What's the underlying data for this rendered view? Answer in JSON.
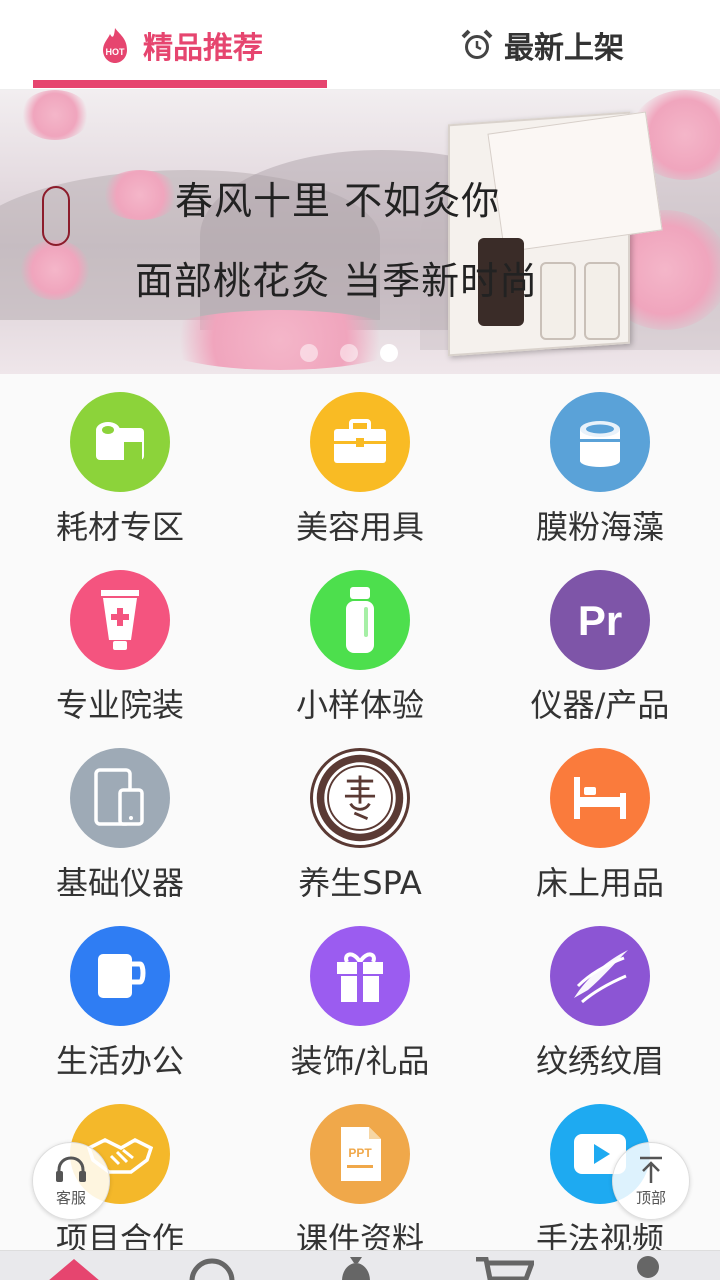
{
  "tabs": {
    "hot": {
      "badge": "HOT",
      "label": "精品推荐"
    },
    "new": {
      "label": "最新上架"
    }
  },
  "banner": {
    "line1": "春风十里 不如灸你",
    "line2": "面部桃花灸 当季新时尚",
    "slides_total": 3,
    "active_slide": 3
  },
  "categories": [
    {
      "label": "耗材专区",
      "icon": "tape-roll-icon",
      "color": "#8cd33a"
    },
    {
      "label": "美容用具",
      "icon": "briefcase-icon",
      "color": "#f9bb24"
    },
    {
      "label": "膜粉海藻",
      "icon": "can-icon",
      "color": "#5aa2d8"
    },
    {
      "label": "专业院装",
      "icon": "tube-icon",
      "color": "#f4547f"
    },
    {
      "label": "小样体验",
      "icon": "bottle-icon",
      "color": "#4ddf4d"
    },
    {
      "label": "仪器/产品",
      "icon": "pr-icon",
      "color": "#7e55a8"
    },
    {
      "label": "基础仪器",
      "icon": "devices-icon",
      "color": "#9eaab6"
    },
    {
      "label": "养生SPA",
      "icon": "yang-seal-icon",
      "color": "#5b3a34"
    },
    {
      "label": "床上用品",
      "icon": "bed-icon",
      "color": "#fa7b3c"
    },
    {
      "label": "生活办公",
      "icon": "mug-icon",
      "color": "#2f7df3"
    },
    {
      "label": "装饰/礼品",
      "icon": "gift-icon",
      "color": "#9b5cf0"
    },
    {
      "label": "纹绣纹眉",
      "icon": "feather-icon",
      "color": "#8c55d4"
    },
    {
      "label": "项目合作",
      "icon": "handshake-icon",
      "color": "#f4b82a"
    },
    {
      "label": "课件资料",
      "icon": "ppt-icon",
      "color": "#f0a84a"
    },
    {
      "label": "手法视频",
      "icon": "play-icon",
      "color": "#1eaaf1"
    }
  ],
  "floating": {
    "service": {
      "label": "客服",
      "icon": "headset-icon"
    },
    "top": {
      "label": "顶部",
      "icon": "arrow-up-icon"
    }
  },
  "colors": {
    "accent": "#e6456f"
  }
}
